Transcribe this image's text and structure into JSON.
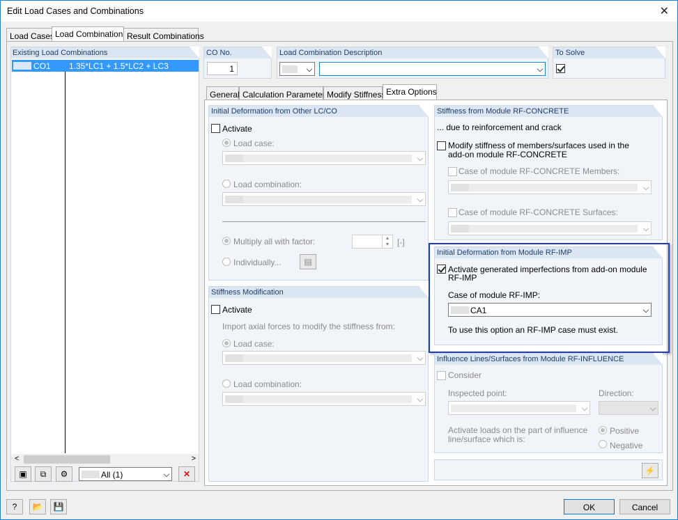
{
  "window": {
    "title": "Edit Load Cases and Combinations"
  },
  "main_tabs": [
    "Load Cases",
    "Load Combinations",
    "Result Combinations"
  ],
  "existing": {
    "header": "Existing Load Combinations",
    "rows": [
      {
        "id": "CO1",
        "formula": "1.35*LC1 + 1.5*LC2 + LC3"
      }
    ],
    "filter_value": "All (1)"
  },
  "co_no": {
    "label": "CO No.",
    "value": "1"
  },
  "description": {
    "label": "Load Combination Description",
    "value": ""
  },
  "to_solve": {
    "label": "To Solve",
    "checked": true
  },
  "sub_tabs": [
    "General",
    "Calculation Parameters",
    "Modify Stiffness",
    "Extra Options"
  ],
  "init_def_other": {
    "title": "Initial Deformation from Other LC/CO",
    "activate": "Activate",
    "load_case": "Load case:",
    "load_combination": "Load combination:",
    "multiply": "Multiply all with factor:",
    "unit": "[-]",
    "individually": "Individually..."
  },
  "stiff_mod": {
    "title": "Stiffness Modification",
    "activate": "Activate",
    "import_text": "Import axial forces to modify the stiffness from:",
    "load_case": "Load case:",
    "load_combination": "Load combination:"
  },
  "rf_concrete": {
    "title": "Stiffness from Module RF-CONCRETE",
    "note": "... due to reinforcement and crack",
    "modify_line1": "Modify stiffness of members/surfaces used in the",
    "modify_line2": "add-on module RF-CONCRETE",
    "members": "Case of module RF-CONCRETE Members:",
    "surfaces": "Case of module RF-CONCRETE Surfaces:"
  },
  "rf_imp": {
    "title": "Initial Deformation from Module RF-IMP",
    "activate_line1": "Activate generated imperfections from add-on module",
    "activate_line2": "RF-IMP",
    "activate_checked": true,
    "case_label": "Case of module RF-IMP:",
    "case_value": "CA1",
    "note": "To use this option an RF-IMP case must exist."
  },
  "rf_influence": {
    "title": "Influence Lines/Surfaces from Module RF-INFLUENCE",
    "consider": "Consider",
    "inspected_point": "Inspected point:",
    "direction": "Direction:",
    "activate_line1": "Activate loads on the part of influence",
    "activate_line2": "line/surface which is:",
    "positive": "Positive",
    "negative": "Negative"
  },
  "buttons": {
    "ok": "OK",
    "cancel": "Cancel"
  },
  "colors": {
    "accent": "#1883d7",
    "highlight_border": "#1f3bbf",
    "selection": "#3399ff"
  }
}
